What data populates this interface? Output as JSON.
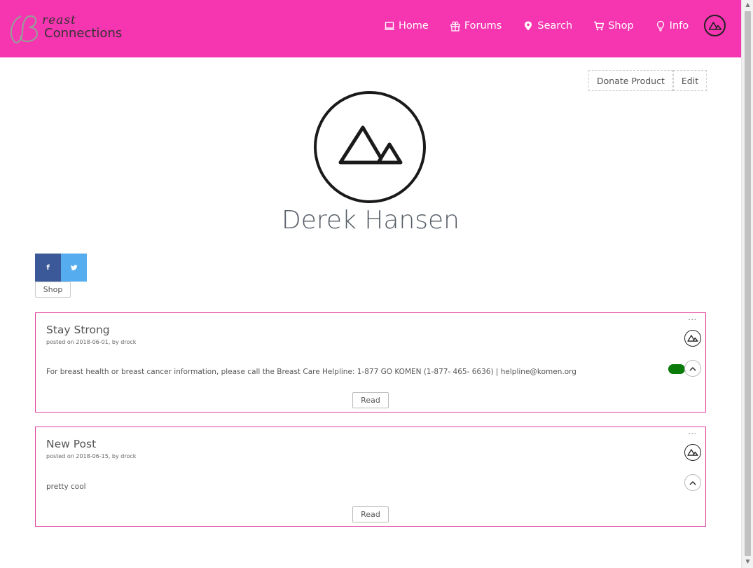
{
  "brand": {
    "script_text": "reast",
    "main_text": "Connections",
    "color": "#f635b0"
  },
  "nav": {
    "items": [
      {
        "label": "Home",
        "icon": "laptop-icon"
      },
      {
        "label": "Forums",
        "icon": "gift-icon"
      },
      {
        "label": "Search",
        "icon": "map-pin-icon"
      },
      {
        "label": "Shop",
        "icon": "cart-icon"
      },
      {
        "label": "Info",
        "icon": "lightbulb-icon"
      }
    ],
    "avatar_icon": "mountain-logo-icon"
  },
  "actions": {
    "donate_label": "Donate Product",
    "edit_label": "Edit"
  },
  "profile": {
    "name": "Derek Hansen",
    "avatar_icon": "mountain-logo-icon"
  },
  "social": {
    "facebook_glyph": "f",
    "twitter_icon": "twitter-icon",
    "facebook_color": "#3b5998",
    "twitter_color": "#55acee"
  },
  "shop_label": "Shop",
  "posts": [
    {
      "title": "Stay Strong",
      "meta": "posted on 2018-06-01, by drock",
      "body": "For breast health or breast cancer information, please call the Breast Care Helpline: 1-877 GO KOMEN (1-877- 465- 6636) | helpline@komen.org",
      "dots": "...",
      "read_label": "Read",
      "toggle_on": true
    },
    {
      "title": "New Post",
      "meta": "posted on 2018-06-15, by drock",
      "body": "pretty cool",
      "dots": "...",
      "read_label": "Read",
      "toggle_on": false
    }
  ]
}
